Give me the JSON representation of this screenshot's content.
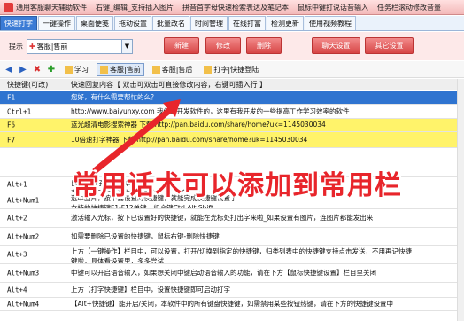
{
  "titlebar": {
    "items": [
      "通用客服聊天辅助软件",
      "右键_编辑_支持插入图片",
      "拼音首字母快速检索表达及笔记本",
      "鼠标中键打说话音输入",
      "任务栏滚动修改音量"
    ]
  },
  "tabs": [
    "快速打字",
    "一键操作",
    "桌面便笺",
    "拖动设置",
    "批量改名",
    "时间管理",
    "在线打富",
    "检测更新",
    "使用视频教程"
  ],
  "active_tab": 0,
  "toolbar": {
    "prompt_label": "提示",
    "category_value": "客服|售前",
    "buttons": [
      "新建",
      "修改",
      "删除",
      "聊天设置",
      "其它设置"
    ]
  },
  "category_tabs": [
    "学习",
    "客服|售前",
    "客服|售后",
    "打字|快捷登陆"
  ],
  "selected_category": 1,
  "table_header": {
    "key": "快捷键(可改)",
    "content": "快速回复内容【 双击可双击可直接修改内容，右键可插入行 】"
  },
  "rows": [
    {
      "key": "F1",
      "lines": [
        "您好，有什么需要帮忙的么？"
      ],
      "style": "blue"
    },
    {
      "key": "Ctrl+1",
      "lines": [
        "http://www.baiyunxy.com    我们是开发软件的，这里有我开发的一些提高工作学习效率的软件"
      ],
      "style": "white"
    },
    {
      "key": "F6",
      "lines": [
        "蓝光超清电影搜索神器  下载  http://pan.baidu.com/share/home?uk=1145030034"
      ],
      "style": "yellow"
    },
    {
      "key": "F7",
      "lines": [
        "10倍速打字神器  下载  http://pan.baidu.com/share/home?uk=1145030034"
      ],
      "style": "yellow"
    },
    {
      "key": "",
      "lines": [
        ""
      ],
      "style": "white"
    },
    {
      "key": "",
      "lines": [
        ""
      ],
      "style": "white"
    },
    {
      "key": "Alt+1",
      "lines": [
        "自创的格子是纯文本",
        "直接的格子中带有你图片内容，右键-编辑内容，可以插入图片"
      ],
      "style": "white"
    },
    {
      "key": "Alt+Num1",
      "lines": [
        "选中图片，按下要设置的快捷键，就能完成快捷键设置了",
        "支持的快捷键F1-F12单键，组合键Ctrl,Alt,Shift"
      ],
      "style": "white"
    },
    {
      "key": "Alt+2",
      "lines": [
        "激活输入光标，按下已设置好的快捷键，就能在光标处打出字来啦_如果设置有图片，连图片都能发出来"
      ],
      "style": "white"
    },
    {
      "key": "Alt+Num2",
      "lines": [
        "如需要删除已设置的快捷键，鼠标右键-删除快捷键"
      ],
      "style": "white"
    },
    {
      "key": "Alt+3",
      "lines": [
        "上方【一键操作】栏目中，可以设置，打开/切换到指定的快捷键，归类列表中的快捷键支持点击发送，不用再记快捷",
        "键啦，具体看设置里，多多尝试"
      ]
    },
    {
      "key": "Alt+Num3",
      "lines": [
        "中键可以开启语音输入，如果想关闭中键启动语音输入的功能，请在下方【鼠标快捷键设置】栏目里关闭"
      ],
      "style": "white"
    },
    {
      "key": "Alt+4",
      "lines": [
        "上方【打字快捷键】栏目中，设置快捷键即可启动打字"
      ],
      "style": "white"
    },
    {
      "key": "Alt+Num4",
      "lines": [
        "【Alt+快捷键】能开启/关闭，本软件中的所有键盘快捷键，如需禁用某些按钮热键，请在下方的快捷键设置中"
      ],
      "style": "white"
    }
  ],
  "overlay_text": "常用话术可以添加到常用栏",
  "colors": {
    "accent": "#3a7bd5",
    "red": "#e8252b",
    "yellow": "#fff36a",
    "selected_row": "#2f74d0"
  }
}
